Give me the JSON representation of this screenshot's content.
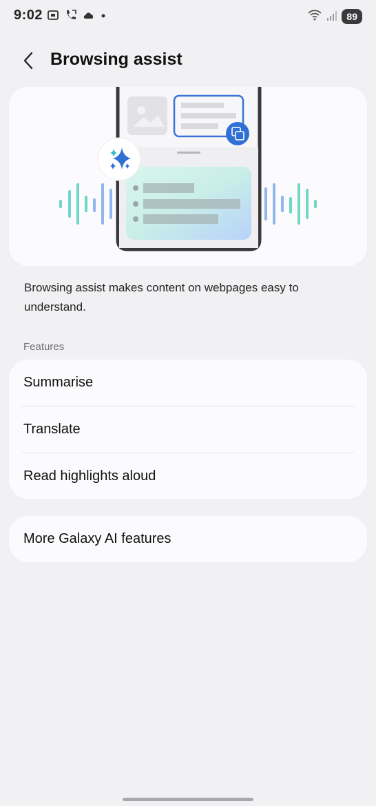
{
  "status_bar": {
    "time": "9:02",
    "battery": "89",
    "left_icons": [
      "screenshot-icon",
      "call-forward-icon",
      "cloud-icon",
      "dot-icon"
    ],
    "right_icons": [
      "wifi-icon",
      "signal-icon"
    ]
  },
  "header": {
    "title": "Browsing assist",
    "back_icon": "chevron-left-icon"
  },
  "hero": {
    "illustration": "browsing-assist-illustration",
    "colors": {
      "accent": "#2f6fd6",
      "wave_teal": "#6fd6c8",
      "wave_blue": "#8fb6ee"
    }
  },
  "description": "Browsing assist makes content on webpages easy to understand.",
  "features": {
    "section_label": "Features",
    "items": [
      {
        "label": "Summarise"
      },
      {
        "label": "Translate"
      },
      {
        "label": "Read highlights aloud"
      }
    ]
  },
  "more": {
    "label": "More Galaxy AI features"
  }
}
